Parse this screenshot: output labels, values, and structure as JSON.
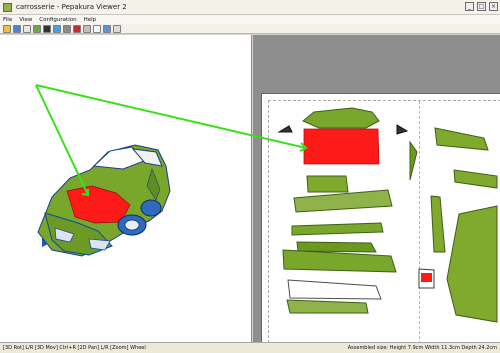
{
  "window": {
    "title": "carrosserie - Pepakura Viewer 2"
  },
  "menu": {
    "items": [
      "File",
      "View",
      "Configuration",
      "Help"
    ]
  },
  "toolbar": {
    "icons": [
      "open-icon",
      "save-icon",
      "print-icon",
      "rotate-icon",
      "model-icon",
      "texture-icon",
      "edge-icon",
      "paint-icon",
      "select-icon",
      "page-icon",
      "zoom-icon",
      "view-icon"
    ]
  },
  "statusbar": {
    "left": "[3D Rot] L/R [3D Mov] Ctrl+R [2D Pan] L/R [Zoom] Wheel",
    "right": "Assembled size: Height 7.9cm Width 11.3cm Depth 24.2cm"
  },
  "colors": {
    "highlight": "#ff1a1a",
    "arrow": "#39e11b",
    "body": "#7faa2e",
    "paper_bg": "#8e8e8e"
  }
}
